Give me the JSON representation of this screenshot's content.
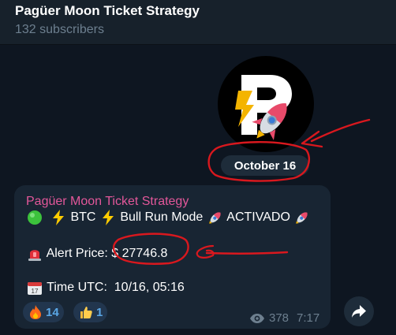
{
  "channel": {
    "title": "Pagüer Moon Ticket Strategy",
    "subscribers": "132 subscribers"
  },
  "date_separator": "October 16",
  "message": {
    "author": "Pagüer Moon Ticket Strategy",
    "line1": {
      "btc": " BTC ",
      "mode": " Bull Run Mode ",
      "status": " ACTIVADO "
    },
    "alert_label": " Alert Price: ",
    "alert_value": "$ 27746.8",
    "time_label": " Time UTC:  10/16, 05:16",
    "reactions": [
      {
        "emoji": "fire-icon",
        "count": "14"
      },
      {
        "emoji": "thumbs-up-icon",
        "count": "1"
      }
    ],
    "views": "378",
    "time": "7:17"
  },
  "colors": {
    "header_bg": "#17212b",
    "chat_bg": "#0e1621",
    "bubble_bg": "#182533",
    "author": "#e3579a",
    "reaction_text": "#5aa7e6",
    "annotation_red": "#d9181e"
  }
}
